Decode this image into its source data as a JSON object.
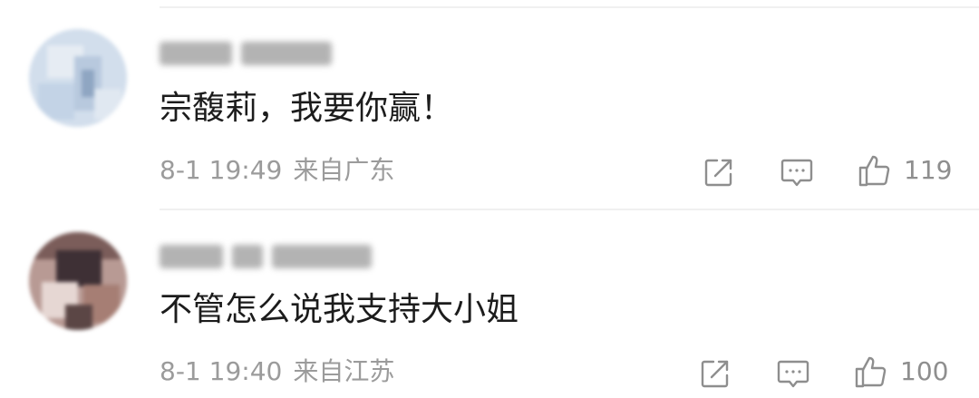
{
  "comments": [
    {
      "text": "宗馥莉，我要你赢！",
      "date": "8-1 19:49",
      "location": "来自广东",
      "likes": "119",
      "avatar_colors": [
        "#cfdced",
        "#b9cbe3",
        "#e8edf4",
        "#8aa0bd",
        "#dfe6ef"
      ]
    },
    {
      "text": "不管怎么说我支持大小姐",
      "date": "8-1 19:40",
      "location": "来自江苏",
      "likes": "100",
      "avatar_colors": [
        "#7a5b58",
        "#c4a8a4",
        "#3d2f34",
        "#e9dcd8",
        "#a47f75"
      ]
    }
  ],
  "icons": [
    "share-icon",
    "comment-icon",
    "like-icon"
  ],
  "colors": {
    "text": "#1c1c1c",
    "meta": "#9b9b9b",
    "divider": "#f0f0f0"
  }
}
